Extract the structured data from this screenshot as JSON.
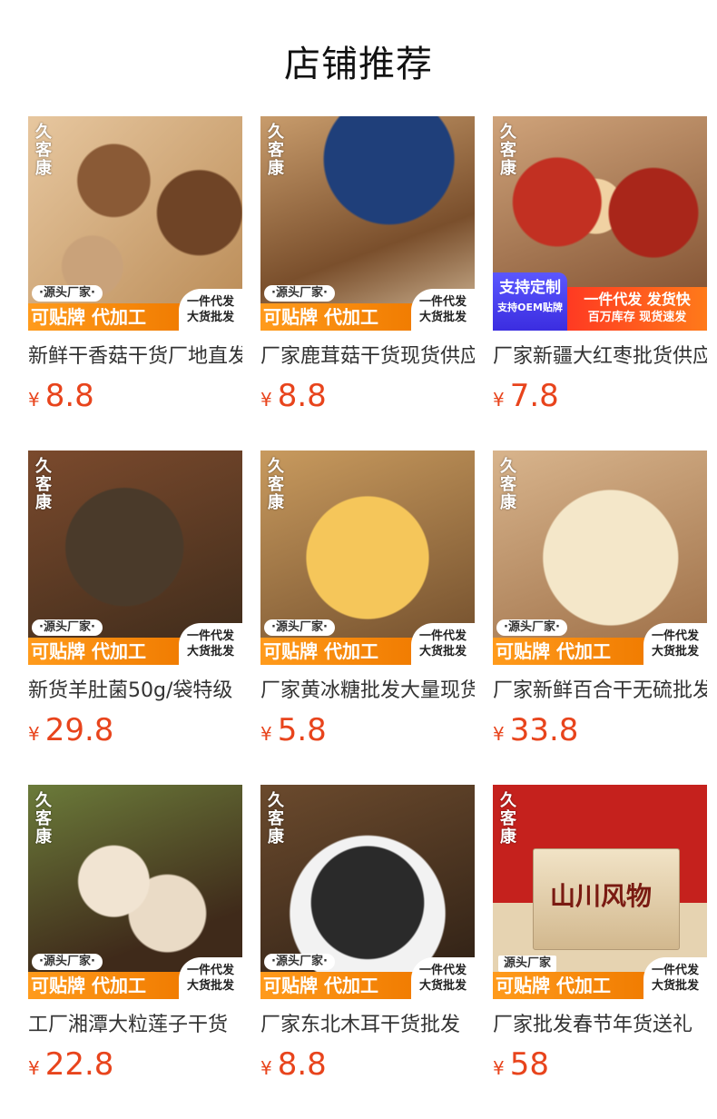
{
  "header": {
    "title": "店铺推荐"
  },
  "brand": {
    "logo_chars": [
      "久",
      "客",
      "康"
    ]
  },
  "band": {
    "tag": "·源头厂家·",
    "main": "可贴牌 代加工",
    "right_line1": "一件代发",
    "right_line2": "大货批发"
  },
  "custom_band": {
    "left_line1": "支持定制",
    "left_line2": "支持OEM贴牌",
    "right_line1": "一件代发 发货快",
    "right_line2": "百万库存 现货速发"
  },
  "last_band": {
    "tag": "源头厂家",
    "main": "可贴牌 代加工",
    "box_text": "山川风物"
  },
  "products": [
    {
      "title": "新鲜干香菇干货厂地直发",
      "currency": "¥",
      "price": "8.8"
    },
    {
      "title": "厂家鹿茸菇干货现货供应",
      "currency": "¥",
      "price": "8.8"
    },
    {
      "title": "厂家新疆大红枣批货供应",
      "currency": "¥",
      "price": "7.8"
    },
    {
      "title": "新货羊肚菌50g/袋特级",
      "currency": "¥",
      "price": "29.8"
    },
    {
      "title": "厂家黄冰糖批发大量现货",
      "currency": "¥",
      "price": "5.8"
    },
    {
      "title": "厂家新鲜百合干无硫批发",
      "currency": "¥",
      "price": "33.8"
    },
    {
      "title": "工厂湘潭大粒莲子干货",
      "currency": "¥",
      "price": "22.8"
    },
    {
      "title": "厂家东北木耳干货批发",
      "currency": "¥",
      "price": "8.8"
    },
    {
      "title": "厂家批发春节年货送礼",
      "currency": "¥",
      "price": "58"
    }
  ]
}
